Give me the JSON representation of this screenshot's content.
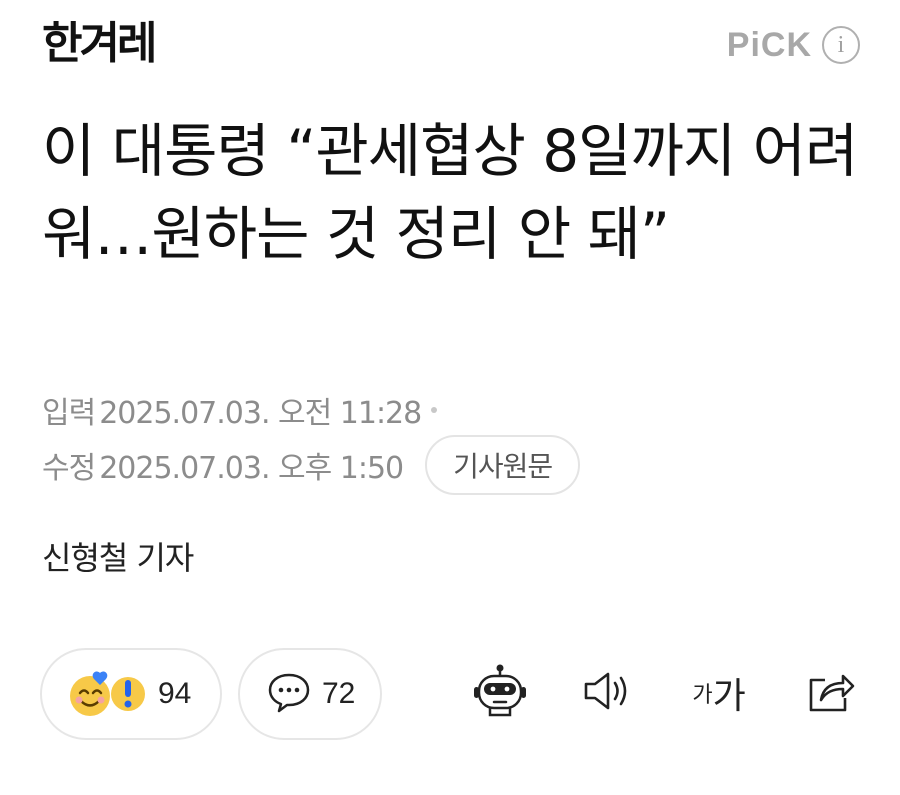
{
  "header": {
    "logo_text": "한겨레",
    "pick_label": "PiCK",
    "info_glyph": "i"
  },
  "article": {
    "headline": "이 대통령 “관세협상 8일까지 어려워…원하는 것 정리 안 돼”",
    "input_label": "입력",
    "input_time": "2025.07.03. 오전 11:28",
    "edit_label": "수정",
    "edit_time": "2025.07.03. 오후 1:50",
    "source_button": "기사원문",
    "reporter": "신형철 기자"
  },
  "actions": {
    "reaction_count": "94",
    "comment_count": "72",
    "font_small": "가",
    "font_big": "가"
  },
  "icons": {
    "reactions": "reaction-emoji-icon",
    "comment": "comment-bubble-icon",
    "summary_bot": "robot-summary-icon",
    "listen": "speaker-icon",
    "font_size": "font-size-icon",
    "share": "share-icon"
  },
  "colors": {
    "meta_gray": "#8c8c8c",
    "pick_gray": "#a8a8a8",
    "emoji_yellow": "#f7c948",
    "accent_blue": "#3b82f6"
  }
}
